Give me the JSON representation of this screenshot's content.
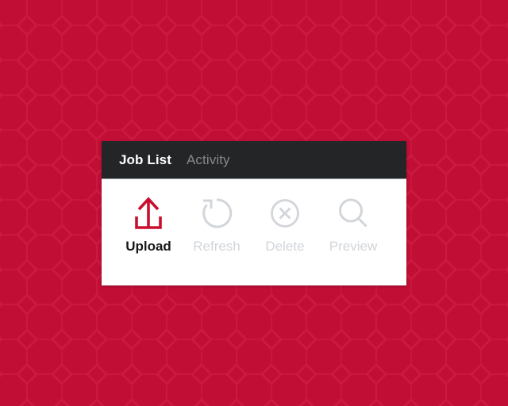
{
  "theme": {
    "background_red": "#c10e35",
    "pattern_line": "#cb1a40",
    "card_background": "#ffffff",
    "tabbar_background": "#232527",
    "accent_red": "#c8102e",
    "disabled_gray": "#d2d5da",
    "active_text": "#ffffff",
    "inactive_tab_text": "#86898c",
    "enabled_label_text": "#17191b"
  },
  "card": {
    "tabs": [
      {
        "label": "Job List",
        "state": "active",
        "icon": ""
      },
      {
        "label": "Activity",
        "state": "inactive",
        "icon": ""
      }
    ],
    "toolbar": {
      "buttons": [
        {
          "label": "Upload",
          "icon": "upload-arrow-tray-icon",
          "state": "enabled",
          "color": "#c8102e"
        },
        {
          "label": "Refresh",
          "icon": "refresh-circular-arrow-icon",
          "state": "disabled",
          "color": "#d2d5da"
        },
        {
          "label": "Delete",
          "icon": "delete-x-circle-icon",
          "state": "disabled",
          "color": "#d2d5da"
        },
        {
          "label": "Preview",
          "icon": "magnifier-search-icon",
          "state": "disabled",
          "color": "#d2d5da"
        }
      ]
    }
  }
}
